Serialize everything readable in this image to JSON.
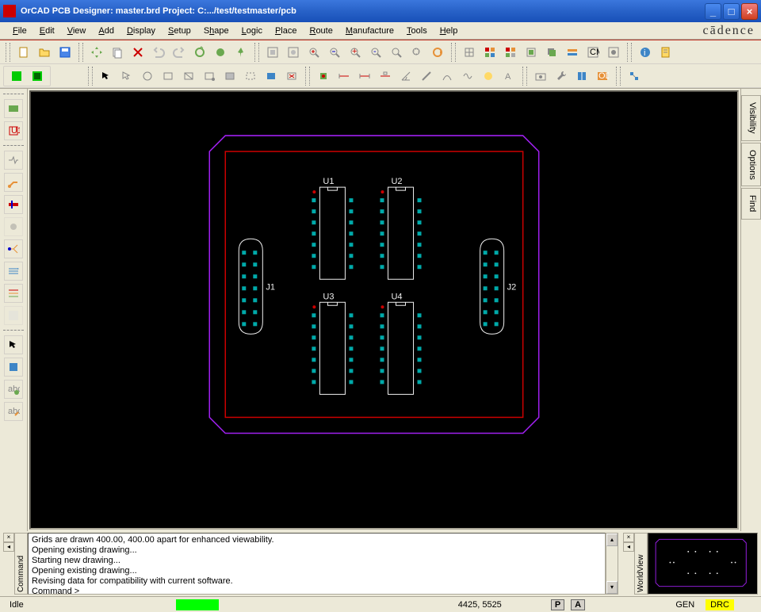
{
  "title": "OrCAD PCB Designer: master.brd  Project: C:.../test/testmaster/pcb",
  "brand": "cādence",
  "menu": [
    "File",
    "Edit",
    "View",
    "Add",
    "Display",
    "Setup",
    "Shape",
    "Logic",
    "Place",
    "Route",
    "Manufacture",
    "Tools",
    "Help"
  ],
  "rtabs": [
    "Visibility",
    "Options",
    "Find"
  ],
  "console": {
    "label": "Command",
    "lines": [
      "Grids are drawn 400.00, 400.00 apart for enhanced viewability.",
      "Opening existing drawing...",
      "Starting new drawing...",
      "Opening existing drawing...",
      "Revising data for compatibility with current software.",
      "Command >"
    ]
  },
  "minimap_label": "WorldView",
  "status": {
    "mode": "Idle",
    "coords": "4425, 5525",
    "p": "P",
    "a": "A",
    "gen": "GEN",
    "drc": "DRC"
  },
  "components": {
    "u1": "U1",
    "u2": "U2",
    "u3": "U3",
    "u4": "U4",
    "j1": "J1",
    "j2": "J2"
  }
}
